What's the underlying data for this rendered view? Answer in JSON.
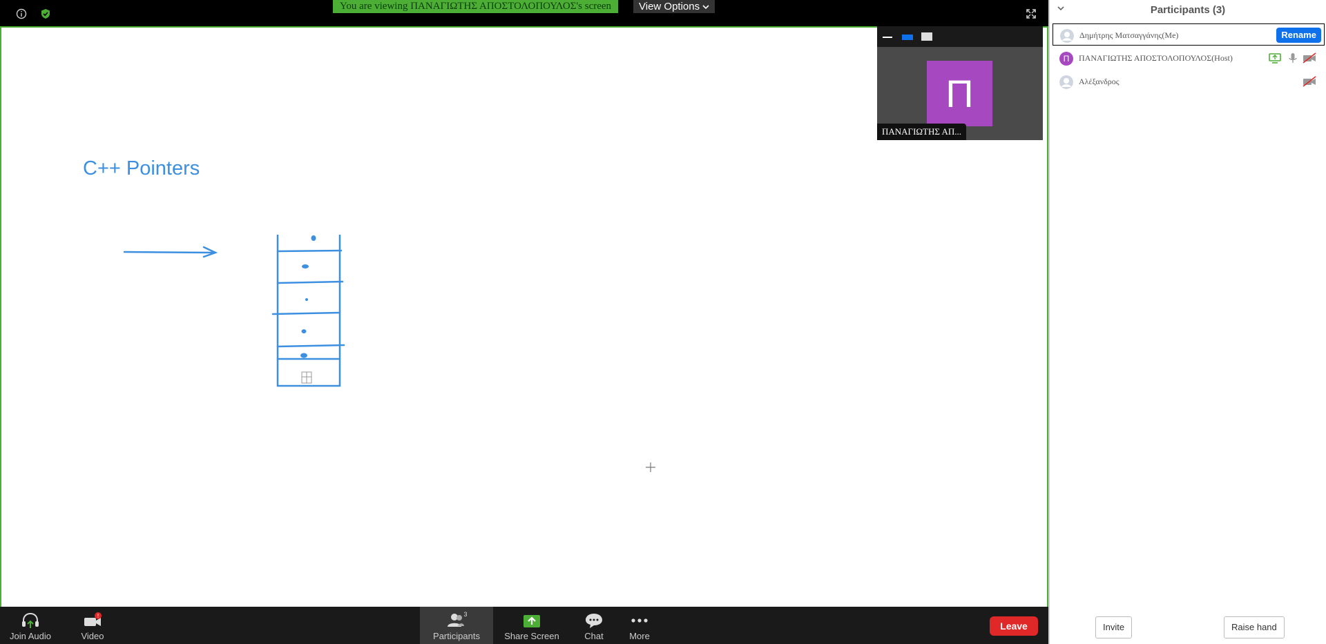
{
  "topbar": {
    "viewing_text": "You are viewing ΠΑΝΑΓΙΩΤΗΣ ΑΠΟΣΤΟΛΟΠΟΥΛΟΣ's screen",
    "view_options_label": "View Options",
    "banner_color": "#4cae35"
  },
  "shared_screen": {
    "title": "C++ Pointers",
    "accent_color": "#3d8fe0"
  },
  "video_tile": {
    "avatar_letter": "Π",
    "name": "ΠΑΝΑΓΙΩΤΗΣ ΑΠ...",
    "avatar_color": "#a648bf"
  },
  "toolbar": {
    "join_audio_label": "Join Audio",
    "video_label": "Video",
    "video_badge": "!",
    "participants_label": "Participants",
    "participants_count": "3",
    "share_screen_label": "Share Screen",
    "chat_label": "Chat",
    "more_label": "More",
    "leave_label": "Leave"
  },
  "panel": {
    "title": "Participants (3)",
    "rename_label": "Rename",
    "invite_label": "Invite",
    "raise_hand_label": "Raise hand",
    "participants": [
      {
        "name": "Δημήτρης Ματσαγγάνης(Me)",
        "avatar": "default"
      },
      {
        "name": "ΠΑΝΑΓΙΩΤΗΣ ΑΠΟΣΤΟΛΟΠΟΥΛΟΣ(Host)",
        "avatar_letter": "Π"
      },
      {
        "name": "Αλέξανδρος",
        "avatar": "default"
      }
    ]
  }
}
